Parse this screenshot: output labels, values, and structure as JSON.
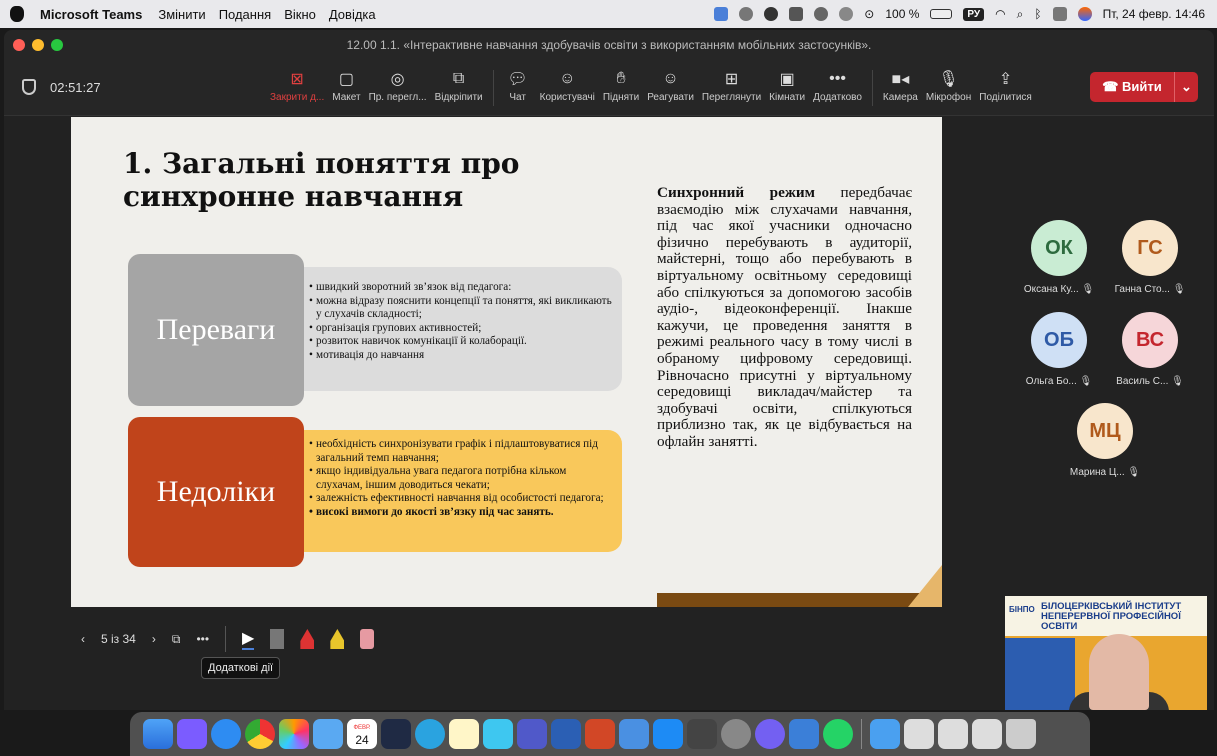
{
  "menubar": {
    "app": "Microsoft Teams",
    "menu": [
      "Змінити",
      "Подання",
      "Вікно",
      "Довідка"
    ],
    "battery": "100 %",
    "lang": "РУ",
    "datetime": "Пт, 24 февр.  14:46"
  },
  "window": {
    "title": "12.00 1.1. «Інтерактивне навчання здобувачів освіти з використанням мобільних застосунків»."
  },
  "toolbar": {
    "timer": "02:51:27",
    "buttons": [
      {
        "label": "Закрити д...",
        "icon": "close-square-icon"
      },
      {
        "label": "Макет",
        "icon": "layout-icon"
      },
      {
        "label": "Пр. перегл...",
        "icon": "eye-icon"
      },
      {
        "label": "Відкріпити",
        "icon": "popout-icon"
      },
      {
        "label": "Чат",
        "icon": "chat-icon"
      },
      {
        "label": "Користувачі",
        "icon": "people-icon"
      },
      {
        "label": "Підняти",
        "icon": "hand-icon"
      },
      {
        "label": "Реагувати",
        "icon": "smile-icon"
      },
      {
        "label": "Переглянути",
        "icon": "grid-icon"
      },
      {
        "label": "Кімнати",
        "icon": "rooms-icon"
      },
      {
        "label": "Додатково",
        "icon": "more-icon"
      },
      {
        "label": "Камера",
        "icon": "camera-icon"
      },
      {
        "label": "Мікрофон",
        "icon": "mic-icon"
      },
      {
        "label": "Поділитися",
        "icon": "share-icon"
      }
    ],
    "exit": "Вийти"
  },
  "slide": {
    "title": "1. Загальні поняття про синхронне навчання",
    "adv_label": "Переваги",
    "disadv_label": "Недоліки",
    "advantages": [
      "швидкий зворотний зв’язок від педагога:",
      "можна відразу пояснити концепції та поняття, які викликають у слухачів складності;",
      "організація групових активностей;",
      "розвиток навичок комунікації й колаборації.",
      "мотивація до навчання"
    ],
    "disadvantages": [
      "необхідність синхронізувати графік і підлаштовуватися під загальний темп навчання;",
      "якщо індивідуальна увага педагога потрібна кільком слухачам, іншим доводиться чекати;",
      "залежність ефективності навчання від особистості педагога;",
      "високі вимоги до якості зв’язку під час занять."
    ],
    "para_bold": "Синхронний режим",
    "para_text": " передбачає взаємодію між слухачами навчання, під час якої учасники одночасно фізично перебувають в аудиторії, майстерні, тощо або перебувають в віртуальному освітньому середовищі або спілкуються за допомогою засобів аудіо-, відеоконференції. Інакше кажучи, це проведення заняття в режимі реального часу в тому числі в обраному цифровому середовищі. Рівночасно присутні у віртуальному середовищі викладач/майстер та здобувачі освіти, спілкуються приблизно так, як це відбувається на офлайн занятті."
  },
  "slide_controls": {
    "page": "5 із 34",
    "tooltip": "Додаткові дії"
  },
  "participants": [
    {
      "initials": "ОК",
      "name": "Оксана Ку...",
      "bg": "#c9ecd3",
      "fg": "#2d6b3e"
    },
    {
      "initials": "ГС",
      "name": "Ганна Сто...",
      "bg": "#f8e6cc",
      "fg": "#b05a1c"
    },
    {
      "initials": "ОБ",
      "name": "Ольга Бо...",
      "bg": "#cfe0f5",
      "fg": "#2e5aa6"
    },
    {
      "initials": "ВС",
      "name": "Василь С...",
      "bg": "#f6d6d9",
      "fg": "#c4262e"
    },
    {
      "initials": "МЦ",
      "name": "Марина Ц...",
      "bg": "#f8e6cc",
      "fg": "#b05a1c"
    }
  ],
  "video": {
    "logo": "БІНПО",
    "title": "БІЛОЦЕРКІВСЬКИЙ ІНСТИТУТ НЕПЕРЕРВНОЇ ПРОФЕСІЙНОЇ ОСВІТИ"
  },
  "dock": {
    "calendar_day": "24",
    "calendar_month": "ФЕВР."
  }
}
